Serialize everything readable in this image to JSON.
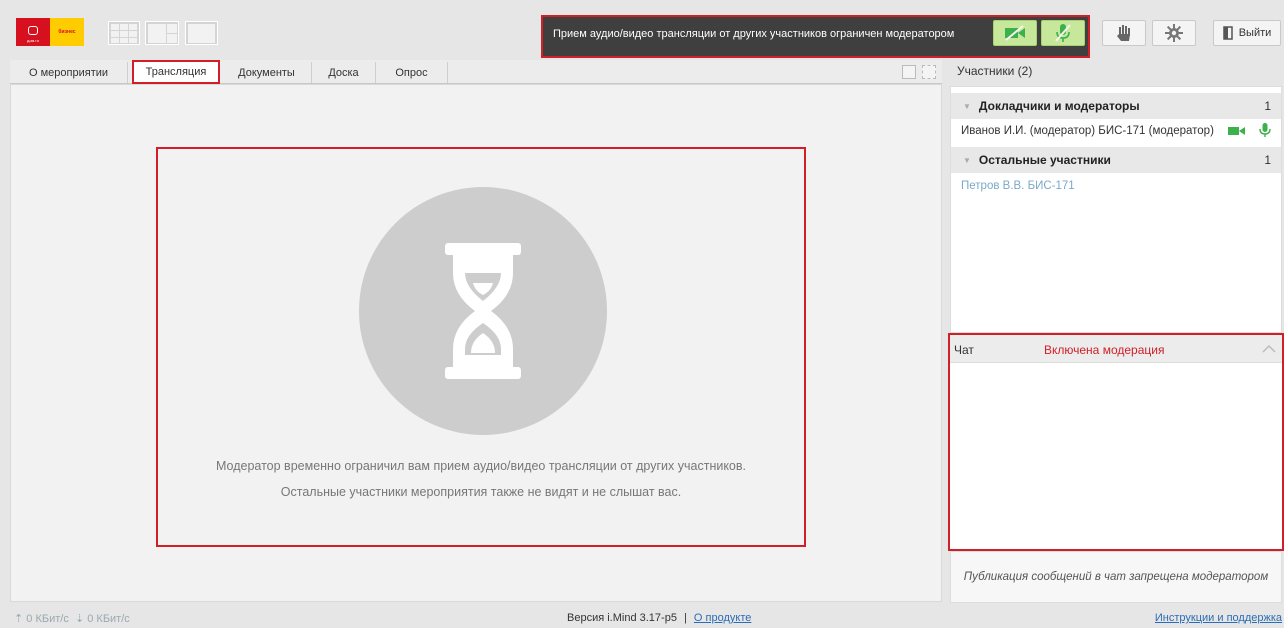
{
  "brand": {
    "logo_left": "дом.ru",
    "logo_right": "бизнес"
  },
  "notice": {
    "text": "Прием аудио/видео трансляции от других участников ограничен модератором"
  },
  "header": {
    "exit_label": "Выйти"
  },
  "tabs": [
    {
      "label": "О мероприятии"
    },
    {
      "label": "Трансляция"
    },
    {
      "label": "Документы"
    },
    {
      "label": "Доска"
    },
    {
      "label": "Опрос"
    }
  ],
  "main": {
    "line1": "Модератор временно ограничил вам прием аудио/видео трансляции от других участников.",
    "line2": "Остальные участники мероприятия также не видят и не слышат вас."
  },
  "participants": {
    "title": "Участники (2)",
    "groups": [
      {
        "name": "Докладчики и модераторы",
        "count": "1",
        "members": [
          "Иванов И.И. (модератор) БИС-171 (модератор)"
        ]
      },
      {
        "name": "Остальные участники",
        "count": "1",
        "members": [
          "Петров В.В. БИС-171"
        ]
      }
    ]
  },
  "chat": {
    "title": "Чат",
    "status": "Включена модерация",
    "footer": "Публикация сообщений в чат запрещена модератором"
  },
  "statusbar": {
    "speed_up": "0 КБит/с",
    "speed_down": "0 КБит/с",
    "version": "Версия i.Mind 3.17-p5",
    "separator": "|",
    "about_link": "О продукте",
    "help_link": "Инструкции и поддержка"
  },
  "colors": {
    "accent_red": "#d01f26",
    "green": "#3cb04a",
    "link": "#2b6db5"
  }
}
